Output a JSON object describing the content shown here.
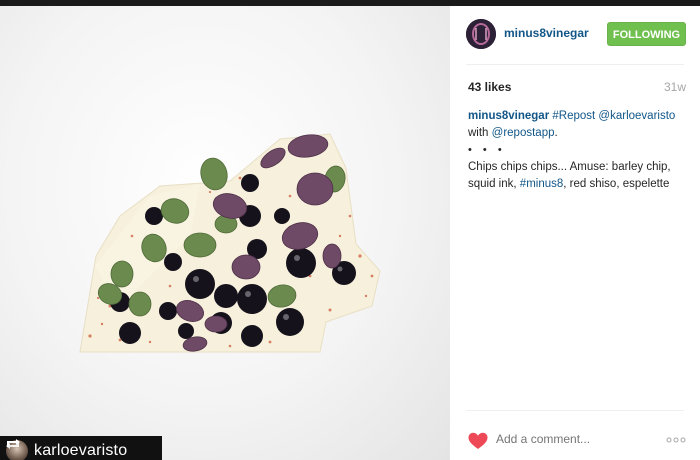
{
  "post": {
    "username": "minus8vinegar",
    "follow_label": "FOLLOWING",
    "likes": "43 likes",
    "age": "31w",
    "caption": {
      "user": "minus8vinegar",
      "hashtag_repost": "#Repost",
      "mention_author": "@karloevaristo",
      "with_text": "with",
      "mention_app": "@repostapp",
      "trail": ".",
      "dots": "• • •",
      "body_1": "Chips chips chips... Amuse: barley chip, squid ink,",
      "hashtag_minus8": "#minus8",
      "body_2": ", red shiso, espelette"
    },
    "comment_placeholder": "Add a comment..."
  },
  "repost_badge": {
    "username": "karloevaristo"
  },
  "icons": {
    "repost": "repost-icon",
    "heart": "heart-icon",
    "more": "more-options-icon"
  },
  "colors": {
    "link": "#125688",
    "follow_button": "#70c050",
    "heart": "#ed4956",
    "muted": "#a5a7aa"
  }
}
